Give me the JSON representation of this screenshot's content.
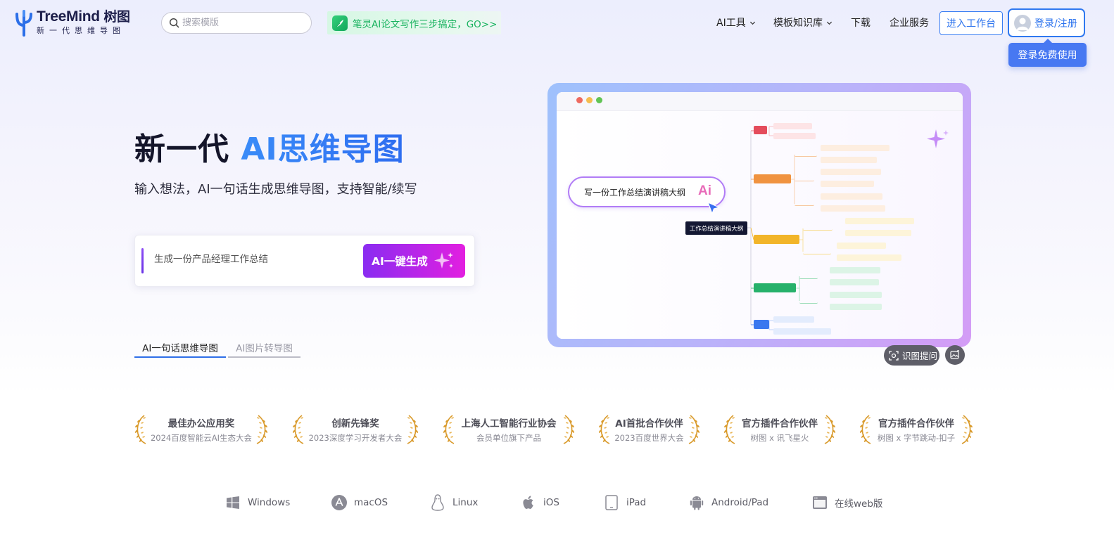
{
  "header": {
    "logo_name": "TreeMind",
    "logo_cn": "树图",
    "logo_slogan": "新一代思维导图",
    "search_placeholder": "搜索模版",
    "promo_text": "笔灵AI论文写作三步搞定，GO>>",
    "nav": [
      {
        "label": "AI工具",
        "dropdown": true
      },
      {
        "label": "模板知识库",
        "dropdown": true
      },
      {
        "label": "下载",
        "dropdown": false
      },
      {
        "label": "企业服务",
        "dropdown": false
      }
    ],
    "workbench_label": "进入工作台",
    "login_label": "登录/注册",
    "login_tip": "登录免费使用"
  },
  "hero": {
    "title_plain": "新一代 ",
    "title_accent": "AI思维导图",
    "subtitle": "输入想法，AI一句话生成思维导图，支持智能/续写",
    "input_value": "生成一份产品经理工作总结",
    "generate_label": "AI一键生成",
    "tabs": [
      {
        "label": "AI一句话思维导图",
        "active": true
      },
      {
        "label": "AI图片转导图",
        "active": false
      }
    ]
  },
  "preview": {
    "prompt": "写一份工作总结演讲稿大纲",
    "prompt_badge": "Ai",
    "root": "工作总结演讲稿大纲",
    "ocr_label": "识图提问"
  },
  "awards": [
    {
      "title": "最佳办公应用奖",
      "subtitle": "2024百度智能云AI生态大会"
    },
    {
      "title": "创新先锋奖",
      "subtitle": "2023深度学习开发者大会"
    },
    {
      "title": "上海人工智能行业协会",
      "subtitle": "会员单位旗下产品"
    },
    {
      "title": "AI首批合作伙伴",
      "subtitle": "2023百度世界大会"
    },
    {
      "title": "官方插件合作伙伴",
      "subtitle": "树图 x 讯飞星火"
    },
    {
      "title": "官方插件合作伙伴",
      "subtitle": "树图 x 字节跳动-扣子"
    }
  ],
  "platforms": [
    {
      "label": "Windows",
      "icon": "windows-icon"
    },
    {
      "label": "macOS",
      "icon": "app-store-icon"
    },
    {
      "label": "Linux",
      "icon": "linux-icon"
    },
    {
      "label": "iOS",
      "icon": "apple-icon"
    },
    {
      "label": "iPad",
      "icon": "tablet-icon"
    },
    {
      "label": "Android/Pad",
      "icon": "android-icon"
    },
    {
      "label": "在线web版",
      "icon": "browser-icon"
    }
  ],
  "colors": {
    "accent_blue": "#2f78f0",
    "generate_gradient_start": "#8a2cf1",
    "generate_gradient_end": "#e21fe0",
    "promo_green": "#19b35f",
    "award_gold": "#d99a2b"
  }
}
